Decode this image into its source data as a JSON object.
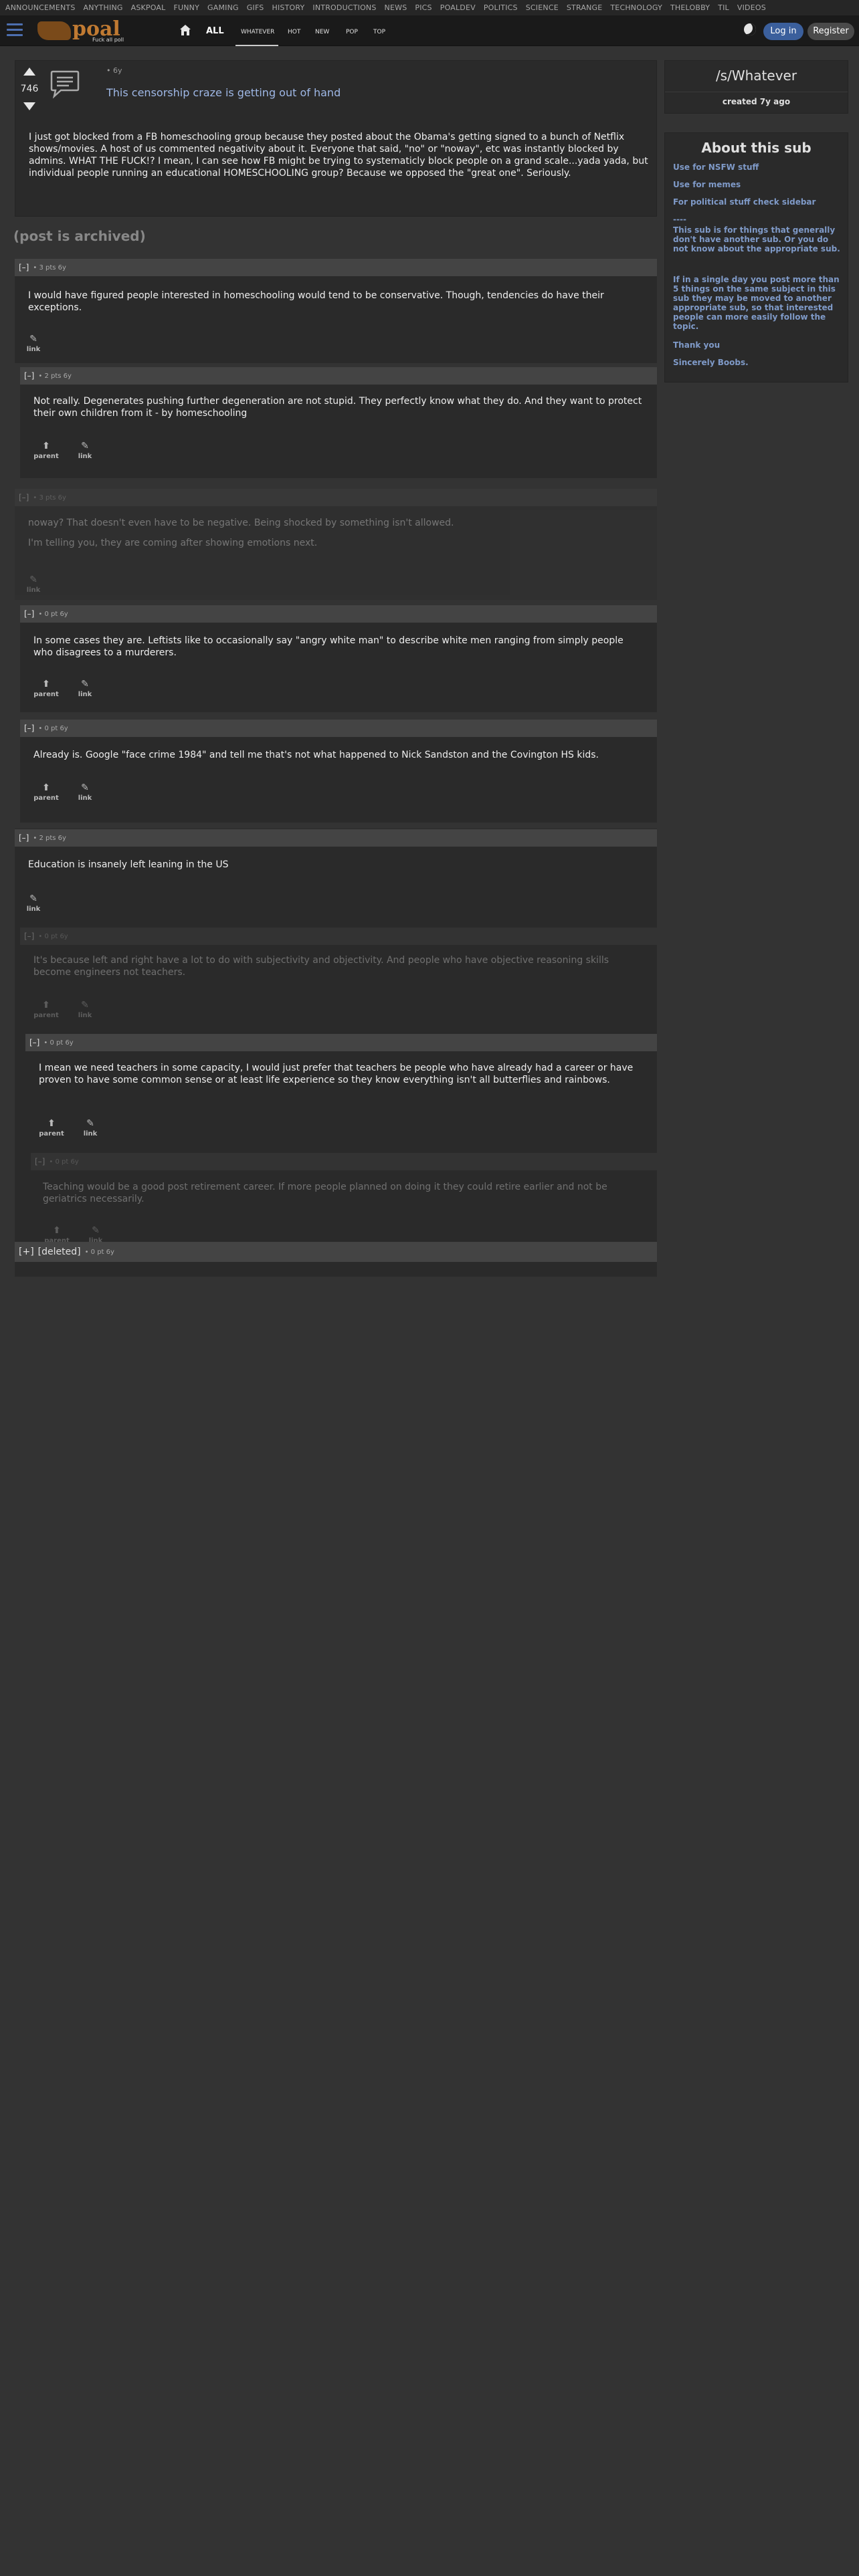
{
  "top_nav": [
    "ANNOUNCEMENTS",
    "ANYTHING",
    "ASKPOAL",
    "FUNNY",
    "GAMING",
    "GIFS",
    "HISTORY",
    "INTRODUCTIONS",
    "NEWS",
    "PICS",
    "POALDEV",
    "POLITICS",
    "SCIENCE",
    "STRANGE",
    "TECHNOLOGY",
    "THELOBBY",
    "TIL",
    "VIDEOS"
  ],
  "header": {
    "logo_text": "poal",
    "logo_sub": "Fuck all poll",
    "all_label": "ALL",
    "tabs": [
      "WHATEVER",
      "HOT",
      "NEW",
      "POP",
      "TOP"
    ],
    "login": "Log in",
    "register": "Register"
  },
  "post": {
    "score": "746",
    "age": "• 6y",
    "title": "This censorship craze is getting out of hand",
    "body": "I just got blocked from a FB homeschooling group because they posted about the Obama's getting signed to a bunch of Netflix shows/movies. A host of us commented negativity about it. Everyone that said, \"no\" or \"noway\", etc was instantly blocked by admins. WHAT THE FUCK!? I mean, I can see how FB might be trying to systematicly block people on a grand scale...yada yada, but individual people running an educational HOMESCHOOLING group? Because we opposed the \"great one\". Seriously."
  },
  "archived_label": "(post is archived)",
  "comments": [
    {
      "toggle": "[–]",
      "meta": "• 3 pts 6y",
      "text": "I would have figured people interested in homeschooling would tend to be conservative. Though, tendencies do have their exceptions.",
      "actions": [
        "link"
      ]
    },
    {
      "toggle": "[–]",
      "meta": "• 2 pts 6y",
      "text": "Not really. Degenerates pushing further degeneration are not stupid. They perfectly know what they do. And they want to protect their own children from it - by homeschooling",
      "actions": [
        "parent",
        "link"
      ]
    },
    {
      "toggle": "[–]",
      "meta": "• 3 pts 6y",
      "text": "noway? That doesn't even have to be negative. Being shocked by something isn't allowed.",
      "text2": "I'm telling you, they are coming after showing emotions next.",
      "actions": [
        "link"
      ]
    },
    {
      "toggle": "[–]",
      "meta": "• 0 pt 6y",
      "text": "In some cases they are. Leftists like to occasionally say \"angry white man\" to describe white men ranging from simply people who disagrees to a murderers.",
      "actions": [
        "parent",
        "link"
      ]
    },
    {
      "toggle": "[–]",
      "meta": "• 0 pt 6y",
      "text": "Already is. Google \"face crime 1984\" and tell me that's not what happened to Nick Sandston and the Covington HS kids.",
      "actions": [
        "parent",
        "link"
      ]
    },
    {
      "toggle": "[–]",
      "meta": "• 2 pts 6y",
      "text": "Education is insanely left leaning in the US",
      "actions": [
        "link"
      ]
    },
    {
      "toggle": "[–]",
      "meta": "• 0 pt 6y",
      "text": "It's because left and right have a lot to do with subjectivity and objectivity. And people who have objective reasoning skills become engineers not teachers.",
      "actions": [
        "parent",
        "link"
      ]
    },
    {
      "toggle": "[–]",
      "meta": "• 0 pt 6y",
      "text": "I mean we need teachers in some capacity, I would just prefer that teachers be people who have already had a career or have proven to have some common sense or at least life experience so they know everything isn't all butterflies and rainbows.",
      "actions": [
        "parent",
        "link"
      ]
    },
    {
      "toggle": "[–]",
      "meta": "• 0 pt 6y",
      "text": "Teaching would be a good post retirement career. If more people planned on doing it they could retire earlier and not be geriatrics necessarily.",
      "actions": [
        "parent",
        "link"
      ]
    }
  ],
  "deleted": {
    "toggle": "[+]",
    "label": "[deleted]",
    "meta": "• 0 pt 6y"
  },
  "sidebar": {
    "title": "/s/Whatever",
    "created": "created 7y ago",
    "about_title": "About this sub",
    "lines": [
      "Use for NSFW stuff",
      "Use for memes",
      "For political stuff check sidebar",
      "----",
      "This sub is for things that generally don't have another sub. Or you do not know about the appropriate sub.",
      "If in a single day you post more than 5 things on the same subject in this sub they may be moved to another appropriate sub, so that interested people can more easily follow the topic.",
      "Thank you",
      "Sincerely Boobs."
    ]
  },
  "colors": {
    "link": "#9fb8e6",
    "accent": "#3b5f9c",
    "sidebar_text": "#7f9ac8"
  }
}
